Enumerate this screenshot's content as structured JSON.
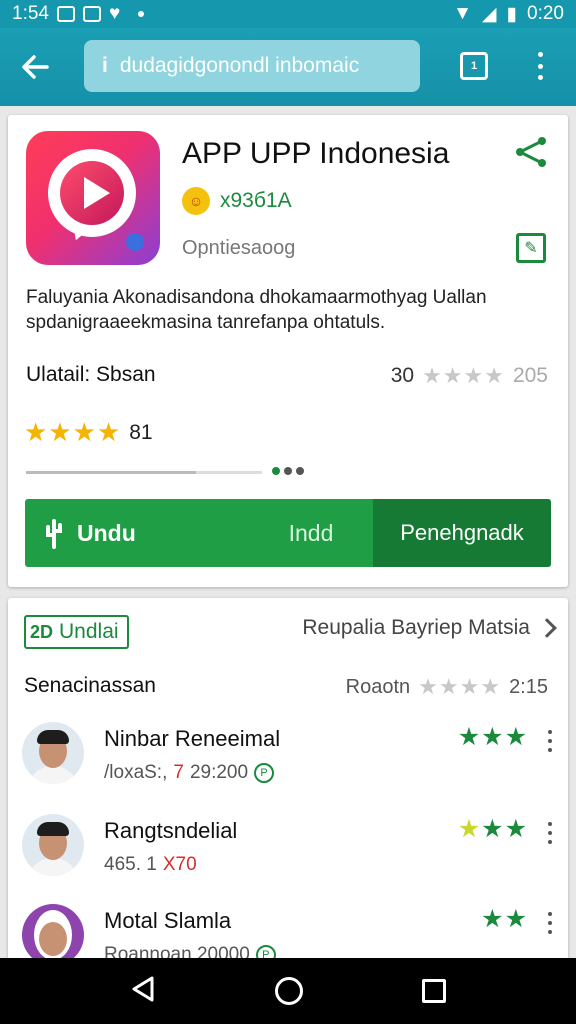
{
  "status_bar": {
    "time_left": "1:54",
    "time_right": "0:20"
  },
  "toolbar": {
    "url_text": "dudagidgonondl inbomaic",
    "tab_count": "1"
  },
  "app": {
    "title": "APP UPP Indonesia",
    "developer": "x93б1A",
    "category": "Opntiesaoog",
    "description": "Faluyania Akonadisandona dhokamaarmothyag Uallan spdanigraaeekmasina tanrefanpa ohtatuls.",
    "meta_label": "Ulatail: Sbsan",
    "meta_count": "30",
    "meta_count2": "205",
    "stars_grey": "★★★★",
    "rating_stars": "★★★★",
    "rating_value": "81",
    "progress_fraction": 0.72
  },
  "actions": {
    "install": "Undu",
    "open": "Indd",
    "secondary": "Penehgnadk"
  },
  "reviews_section": {
    "chip_icon": "2D",
    "chip_label": "Undlai",
    "more_link": "Reupalia Bayriep Matsia",
    "sort_label": "Senacinassan",
    "sort_right_label": "Roaotn",
    "sort_stars": "★★★★",
    "sort_value": "2:15",
    "items": [
      {
        "name": "Ninbar Reneeimal",
        "sub": "/loxaS:,",
        "sub_red": "7",
        "sub_tail": "29:200",
        "sub_icon": "P",
        "stars": "★★★",
        "stars_yellow": ""
      },
      {
        "name": "Rangtsndelial",
        "sub": "465. 1",
        "sub_red": "X70",
        "sub_tail": "",
        "sub_icon": "",
        "stars": "★★",
        "stars_yellow": "★"
      },
      {
        "name": "Motal Slamla",
        "sub": "Roannoan 20000",
        "sub_red": "",
        "sub_tail": "",
        "sub_icon": "P",
        "stars": "★★",
        "stars_yellow": ""
      }
    ]
  },
  "colors": {
    "accent": "#1597ad",
    "green": "#1f9e45",
    "star_gold": "#f4b400"
  }
}
